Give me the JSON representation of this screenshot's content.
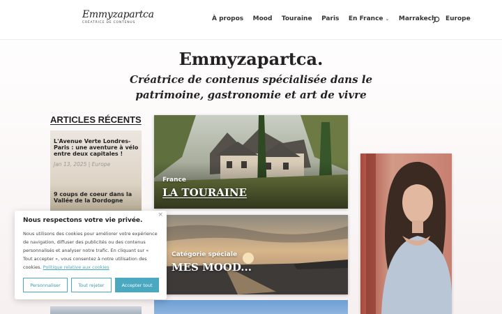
{
  "header": {
    "logo_text": "Emmyzapartca",
    "logo_subtitle": "CRÉATRICE DE CONTENUS",
    "nav": [
      {
        "label": "À propos",
        "dropdown": false
      },
      {
        "label": "Mood",
        "dropdown": false
      },
      {
        "label": "Touraine",
        "dropdown": false
      },
      {
        "label": "Paris",
        "dropdown": false
      },
      {
        "label": "En France",
        "dropdown": true
      },
      {
        "label": "Marrakech",
        "dropdown": false
      },
      {
        "label": "Europe",
        "dropdown": false
      }
    ],
    "search_icon": "search-icon"
  },
  "hero": {
    "title": "Emmyzapartca.",
    "tagline": "Créatrice de contenus spécialisée dans le patrimoine, gastronomie et art de vivre"
  },
  "articles": {
    "heading": "ARTICLES RÉCENTS",
    "items": [
      {
        "title": "L'Avenue Verte Londres-Paris : une aventure à vélo entre deux capitales !",
        "date": "Jan 13, 2025",
        "category": "Europe",
        "sep": " | "
      },
      {
        "title": "9 coups de coeur dans la Vallée de la Dordogne",
        "date": "",
        "category": "",
        "sep": ""
      }
    ]
  },
  "cards": [
    {
      "category": "France",
      "title": "LA TOURAINE"
    },
    {
      "category": "Catégorie spéciale",
      "title": "MES MOOD..."
    }
  ],
  "cookie": {
    "close": "×",
    "title": "Nous respectons votre vie privée.",
    "text": "Nous utilisons des cookies pour améliorer votre expérience de navigation, diffuser des publicités ou des contenus personnalisés et analyser notre trafic. En cliquant sur « Tout accepter », vous consentez à notre utilisation des cookies.",
    "link": "Politique relative aux cookies",
    "buttons": {
      "personalize": "Personnaliser",
      "reject": "Tout rejeter",
      "accept": "Accepter tout"
    }
  },
  "colors": {
    "accent": "#4aa8c0",
    "text": "#222222",
    "meta": "#999999"
  }
}
